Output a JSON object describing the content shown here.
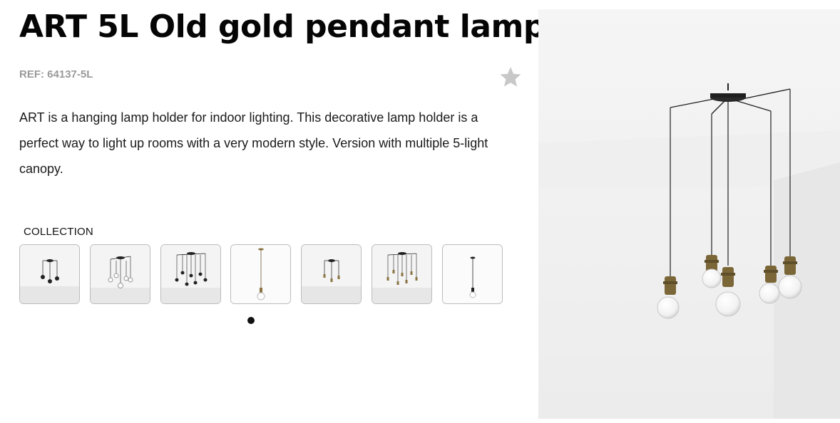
{
  "product": {
    "title": "ART 5L Old gold pendant lamp",
    "ref": "REF: 64137-5L",
    "description": "ART is a hanging lamp holder for indoor lighting. This decorative lamp holder is a perfect way to light up rooms with a very modern style. Version with multiple 5-light canopy.",
    "favorite_icon": "star-icon"
  },
  "collection": {
    "label": "COLLECTION",
    "items": [
      {
        "variant": "3-light black"
      },
      {
        "variant": "5-light black"
      },
      {
        "variant": "7-light black"
      },
      {
        "variant": "1-light old gold"
      },
      {
        "variant": "3-light old gold"
      },
      {
        "variant": "7-light old gold"
      },
      {
        "variant": "1-light black"
      }
    ]
  },
  "carousel": {
    "pages": 1,
    "active": 1
  },
  "colors": {
    "accent": "#111111",
    "ref": "#9a9a9a",
    "gold": "#8a7340"
  }
}
